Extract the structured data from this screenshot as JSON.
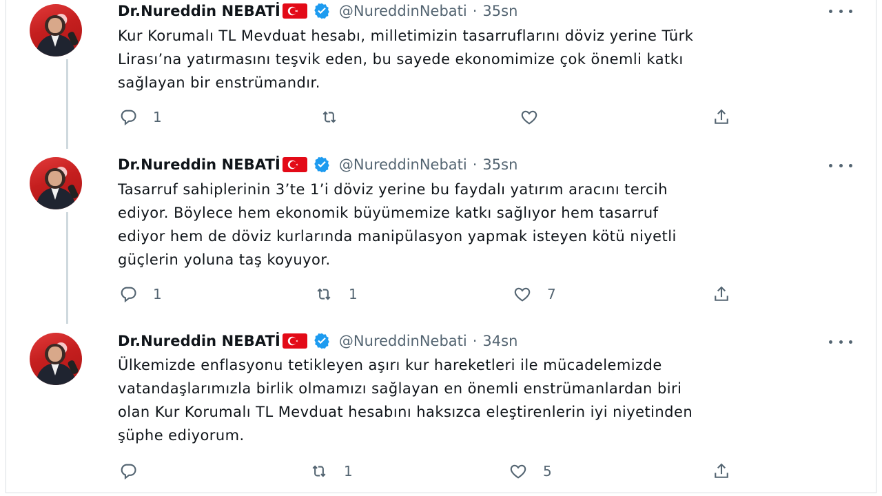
{
  "tweets": [
    {
      "author_name": "Dr.Nureddin NEBATİ",
      "handle": "@NureddinNebati",
      "separator": "·",
      "time": "35sn",
      "lines": [
        "Kur Korumalı TL Mevduat hesabı, milletimizin tasarruflarını döviz yerine Türk",
        "Lirası’na yatırmasını teşvik eden, bu sayede ekonomimize çok önemli katkı",
        "sağlayan bir enstrümandır."
      ],
      "reply_count": "1",
      "retweet_count": "",
      "like_count": ""
    },
    {
      "author_name": "Dr.Nureddin NEBATİ",
      "handle": "@NureddinNebati",
      "separator": "·",
      "time": "35sn",
      "lines": [
        "Tasarruf sahiplerinin 3’te 1’i döviz yerine bu faydalı yatırım aracını tercih",
        "ediyor. Böylece hem ekonomik büyümemize katkı sağlıyor hem tasarruf",
        "ediyor hem de döviz kurlarında manipülasyon yapmak isteyen kötü niyetli",
        "güçlerin yoluna taş koyuyor."
      ],
      "reply_count": "1",
      "retweet_count": "1",
      "like_count": "7"
    },
    {
      "author_name": "Dr.Nureddin NEBATİ",
      "handle": "@NureddinNebati",
      "separator": "·",
      "time": "34sn",
      "lines": [
        "Ülkemizde enflasyonu tetikleyen aşırı kur hareketleri ile mücadelemizde",
        "vatandaşlarımızla birlik olmamızı sağlayan en önemli enstrümanlardan biri",
        "olan Kur Korumalı TL Mevduat hesabını haksızca eleştirenlerin iyi niyetinden",
        "şüphe ediyorum."
      ],
      "reply_count": "",
      "retweet_count": "1",
      "like_count": "5"
    }
  ],
  "icons": {
    "reply": "reply-icon",
    "retweet": "retweet-icon",
    "like": "like-icon",
    "share": "share-icon",
    "verified": "verified-badge-icon",
    "flag": "turkey-flag-icon",
    "more": "more-options-icon"
  },
  "colors": {
    "verified_blue": "#1d9bf0",
    "secondary_text": "#536471",
    "flag_red": "#e30a17"
  }
}
